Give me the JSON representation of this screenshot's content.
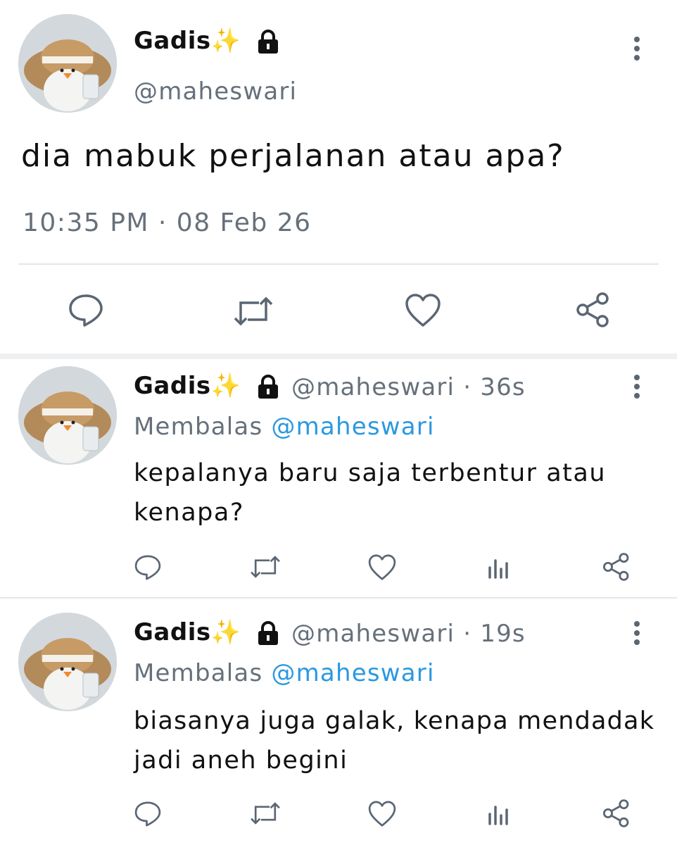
{
  "main_tweet": {
    "display_name": "Gadis",
    "sparkle_emoji": "✨",
    "handle": "@maheswari",
    "text": "dia mabuk perjalanan atau apa?",
    "timestamp": "10:35 PM · 08 Feb 26"
  },
  "replies": [
    {
      "display_name": "Gadis",
      "sparkle_emoji": "✨",
      "handle": "@maheswari",
      "time": "· 36s",
      "replying_label": "Membalas",
      "replying_to": "@maheswari",
      "text_line1": "kepalanya baru saja terbentur atau",
      "text_line2": "kenapa?"
    },
    {
      "display_name": "Gadis",
      "sparkle_emoji": "✨",
      "handle": "@maheswari",
      "time": "· 19s",
      "replying_label": "Membalas",
      "replying_to": "@maheswari",
      "text_line1": "biasanya juga galak, kenapa mendadak",
      "text_line2": "jadi aneh begini"
    }
  ],
  "icons": [
    "lock-icon",
    "more-options-icon",
    "reply-icon",
    "retweet-icon",
    "like-icon",
    "views-icon",
    "share-icon"
  ],
  "colors": {
    "link": "#2b98e0",
    "secondary_text": "#66707b",
    "icon": "#5b6673"
  }
}
